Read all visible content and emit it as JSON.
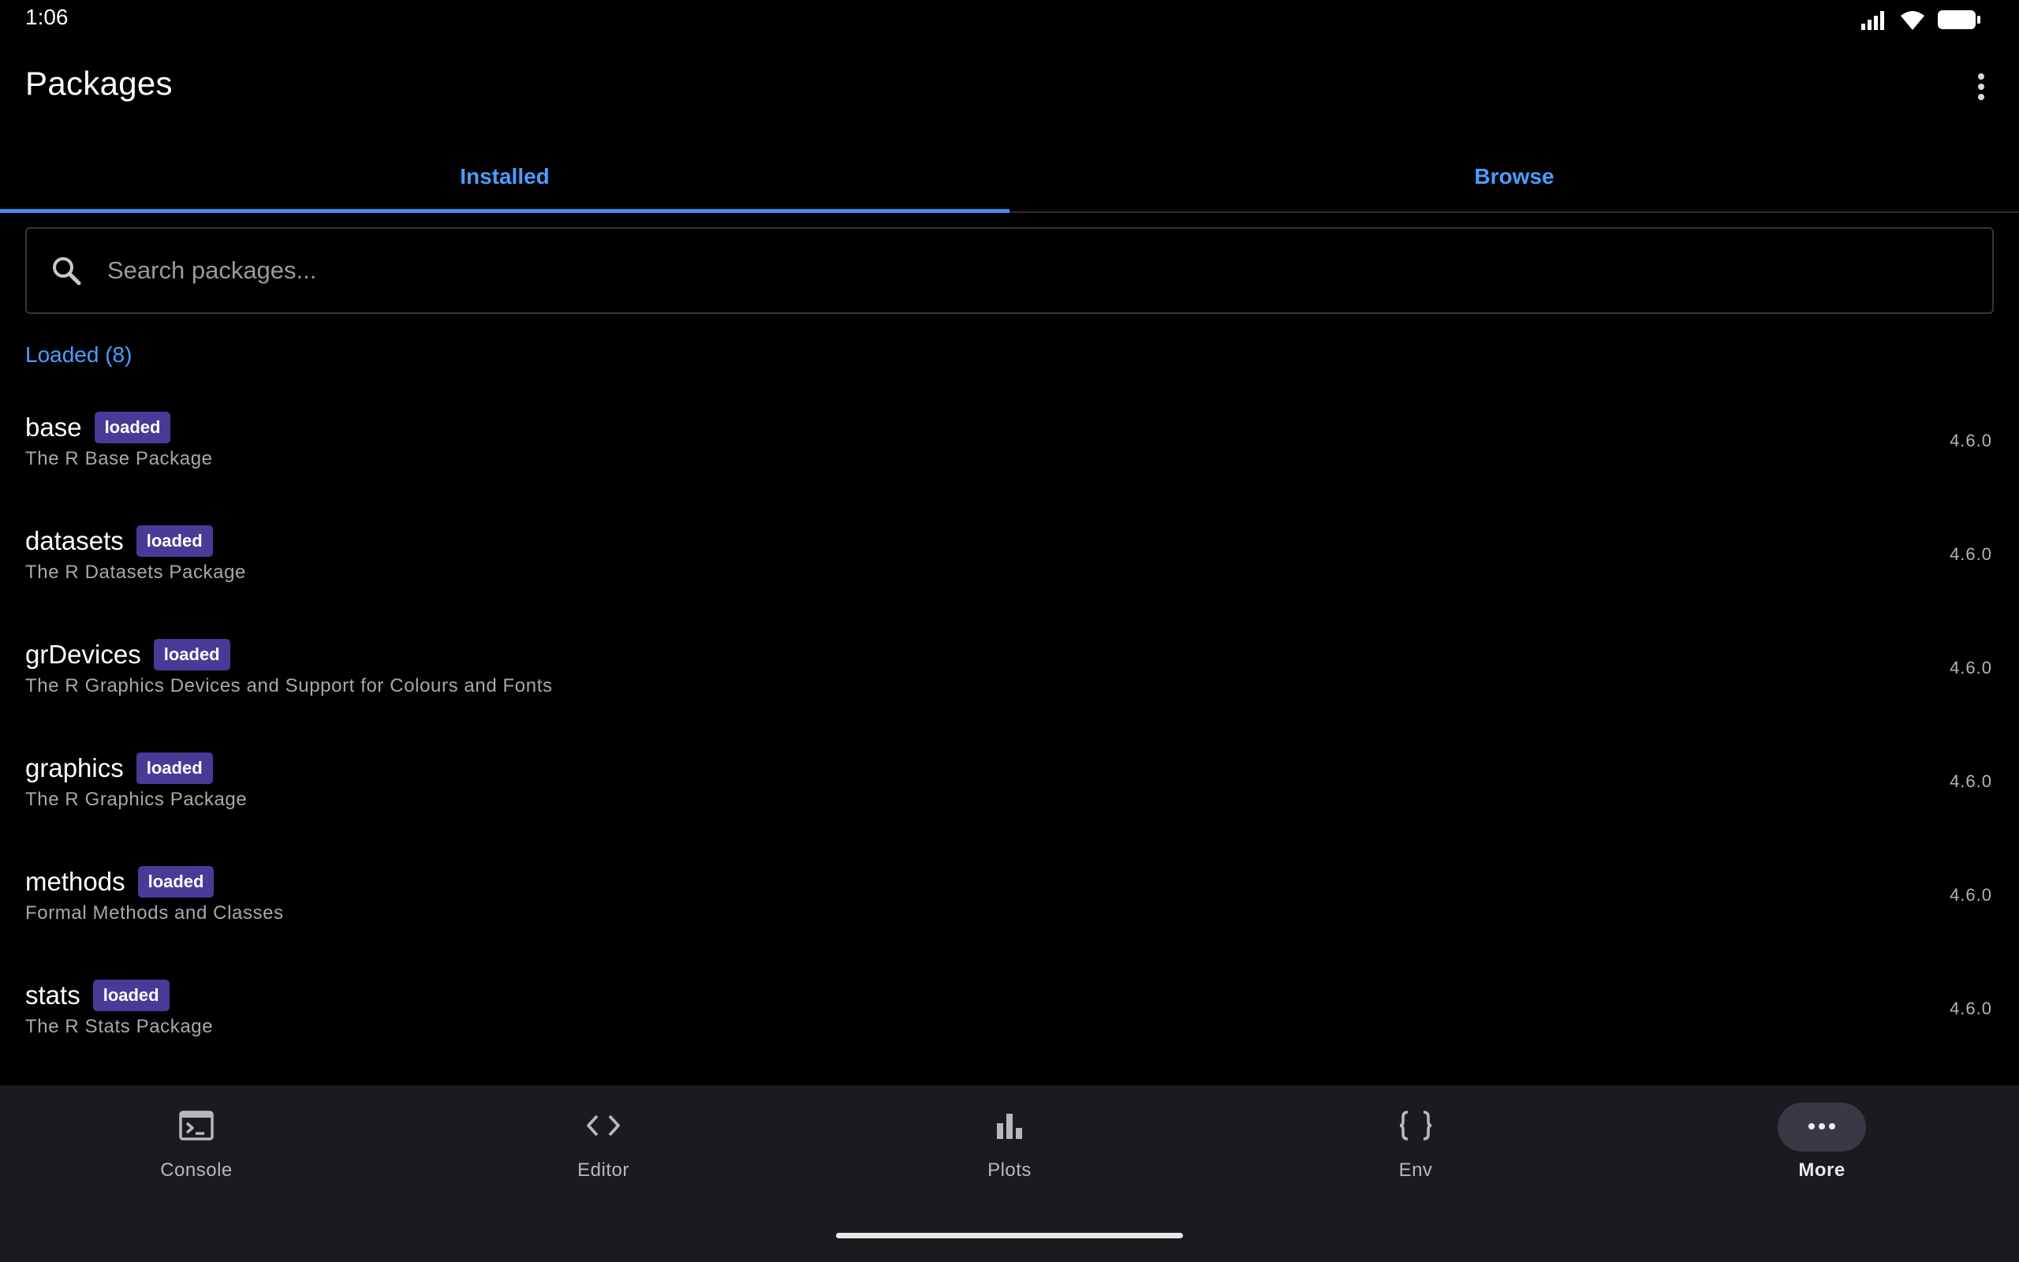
{
  "status_bar": {
    "time": "1:06",
    "icons": [
      "signal-icon",
      "wifi-icon",
      "battery-icon"
    ]
  },
  "app_bar": {
    "title": "Packages",
    "overflow_icon": "more-vert-icon"
  },
  "tabs": [
    {
      "label": "Installed",
      "active": true
    },
    {
      "label": "Browse",
      "active": false
    }
  ],
  "search": {
    "value": "",
    "placeholder": "Search packages...",
    "icon": "search-icon"
  },
  "section": {
    "title": "Loaded (8)"
  },
  "packages": [
    {
      "name": "base",
      "badge": "loaded",
      "description": "The R Base Package",
      "version": "4.6.0"
    },
    {
      "name": "datasets",
      "badge": "loaded",
      "description": "The R Datasets Package",
      "version": "4.6.0"
    },
    {
      "name": "grDevices",
      "badge": "loaded",
      "description": "The R Graphics Devices and Support for Colours and Fonts",
      "version": "4.6.0"
    },
    {
      "name": "graphics",
      "badge": "loaded",
      "description": "The R Graphics Package",
      "version": "4.6.0"
    },
    {
      "name": "methods",
      "badge": "loaded",
      "description": "Formal Methods and Classes",
      "version": "4.6.0"
    },
    {
      "name": "stats",
      "badge": "loaded",
      "description": "The R Stats Package",
      "version": "4.6.0"
    }
  ],
  "bottom_nav": [
    {
      "label": "Console",
      "icon": "terminal-icon",
      "selected": false
    },
    {
      "label": "Editor",
      "icon": "code-icon",
      "selected": false
    },
    {
      "label": "Plots",
      "icon": "bar-chart-icon",
      "selected": false
    },
    {
      "label": "Env",
      "icon": "braces-icon",
      "selected": false
    },
    {
      "label": "More",
      "icon": "more-horiz-icon",
      "selected": true
    }
  ],
  "colors": {
    "background": "#000000",
    "accent": "#4a9eff",
    "tab_indicator": "#3d8ef0",
    "badge": "#4a3a97",
    "nav_background": "#1b1b1f",
    "nav_selected_pill": "#3b3846",
    "secondary_text": "#a8a8ac"
  }
}
